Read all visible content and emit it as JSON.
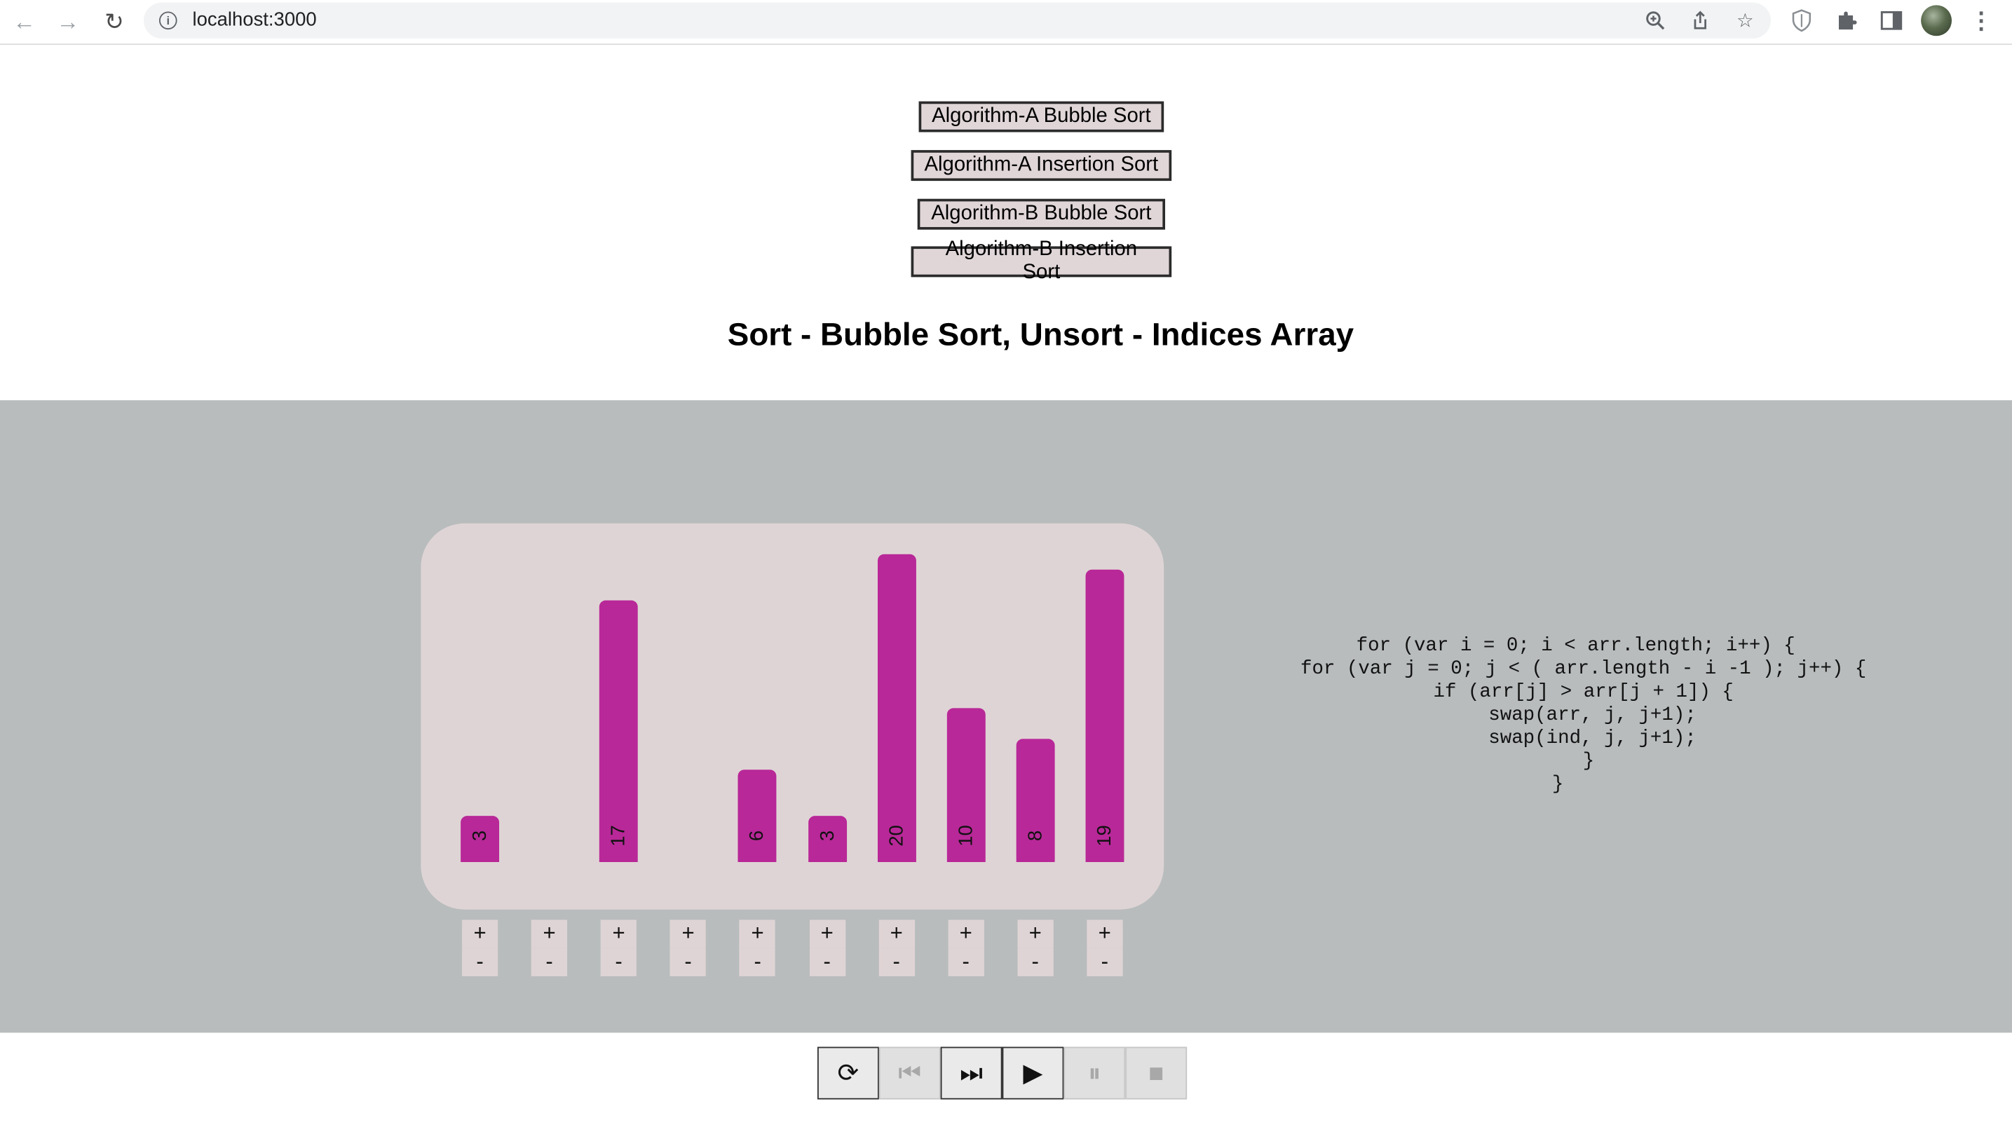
{
  "browser": {
    "url": "localhost:3000",
    "back_icon": "arrow-left-icon",
    "forward_icon": "arrow-right-icon",
    "reload_icon": "reload-icon",
    "info_icon": "info-icon",
    "zoom_icon": "zoom-icon",
    "share_icon": "share-icon",
    "star_icon": "star-icon",
    "shield_icon": "shield-icon",
    "extensions_icon": "puzzle-icon",
    "sidepanel_icon": "side-panel-icon",
    "menu_icon": "kebab-menu-icon"
  },
  "algorithm_buttons": [
    {
      "label": "Algorithm-A Bubble Sort"
    },
    {
      "label": "Algorithm-A Insertion Sort"
    },
    {
      "label": "Algorithm-B Bubble Sort"
    },
    {
      "label": "Algorithm-B Insertion Sort"
    }
  ],
  "heading": "Sort - Bubble Sort, Unsort - Indices Array",
  "colors": {
    "bar": "#b82898",
    "card": "#dfd4d5",
    "band": "#b8bcbd"
  },
  "chart_data": {
    "type": "bar",
    "values": [
      3,
      0,
      17,
      0,
      6,
      3,
      20,
      10,
      8,
      19
    ],
    "labels": [
      "3",
      "",
      "17",
      "",
      "6",
      "3",
      "20",
      "10",
      "8",
      "19"
    ],
    "ylim": [
      0,
      20
    ]
  },
  "steppers": {
    "plus": "+",
    "minus": "-"
  },
  "code_lines": [
    "for (var i = 0; i < arr.length; i++) {",
    "for (var j = 0; j < ( arr.length - i -1 ); j++) {",
    "if (arr[j] > arr[j + 1]) {",
    "swap(arr, j, j+1);",
    "swap(ind, j, j+1);",
    "}",
    "}"
  ],
  "player": [
    {
      "icon": "restart-icon",
      "glyph": "⟳",
      "enabled": true
    },
    {
      "icon": "step-back-icon",
      "glyph": "⏮",
      "enabled": false
    },
    {
      "icon": "step-forward-icon",
      "glyph": "⏭",
      "enabled": true
    },
    {
      "icon": "play-icon",
      "glyph": "▶",
      "enabled": true
    },
    {
      "icon": "pause-icon",
      "glyph": "⏸",
      "enabled": false
    },
    {
      "icon": "stop-icon",
      "glyph": "■",
      "enabled": false
    }
  ]
}
